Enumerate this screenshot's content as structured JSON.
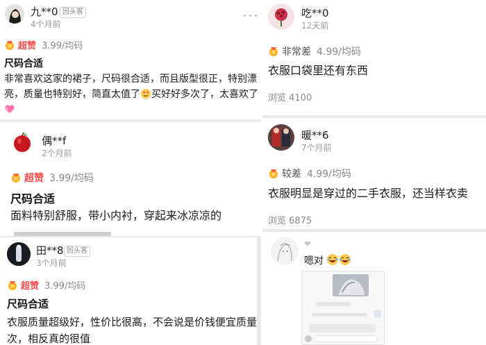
{
  "reviews": [
    {
      "user": "九**0",
      "tag": "回头客",
      "time": "4个月前",
      "rating_label": "超赞",
      "rating_score": "3.99/均码",
      "title": "尺码合适",
      "body_lines": [
        "非常喜欢这家的裙子，尺码很合适，而且版型很正，特别漂",
        "亮，质量也特别好，简直太值了",
        "买好好多次了，太喜欢了"
      ]
    },
    {
      "user": "偶**f",
      "time": "2个月前",
      "rating_label": "超赞",
      "rating_score": "3.99/均码",
      "title": "尺码合适",
      "body": "面料特别舒服，带小内衬，穿起来冰凉凉的"
    },
    {
      "user": "田**8",
      "tag": "回头客",
      "time": "3个月前",
      "rating_label": "超赞",
      "rating_score": "3.99/均码",
      "title": "尺码合适",
      "body_lines": [
        "衣服质量超级好，性价比很高，不会说是价钱便宜质量就很",
        "次，相反真的很值"
      ]
    },
    {
      "user": "吃**0",
      "time": "12天前",
      "rating_label": "非常差",
      "rating_score": "4.99/均码",
      "body": "衣服口袋里还有东西",
      "views": "浏览 4100"
    },
    {
      "user": "暖**6",
      "time": "7个月前",
      "rating_label": "较差",
      "rating_score": "4.99/均码",
      "body": "衣服明显是穿过的二手衣服，还当样衣卖",
      "views": "浏览 6875"
    },
    {
      "comment": "嗯对"
    }
  ],
  "colors": {
    "accent": "#ff4d4f",
    "muted": "#888888",
    "background": "#e9e9ec"
  },
  "icons": [
    "medal-icon",
    "more-dots-icon",
    "heart-icon",
    "laughing-emoji",
    "love-face-emoji"
  ]
}
